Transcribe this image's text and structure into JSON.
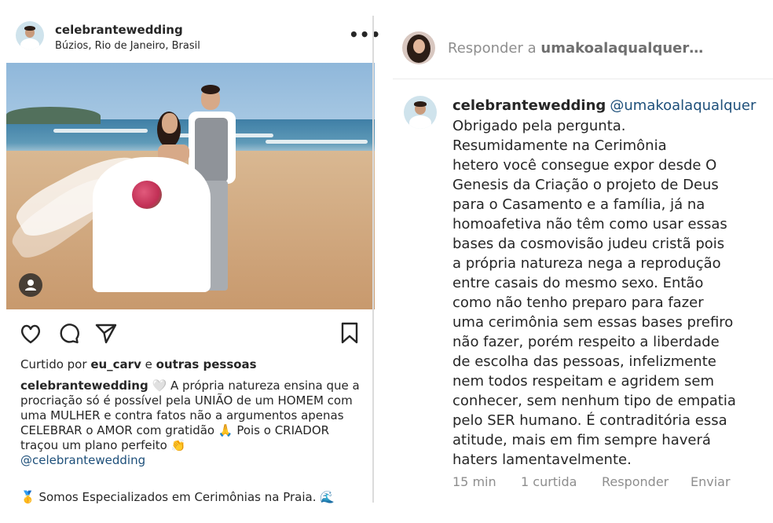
{
  "post": {
    "username": "celebrantewedding",
    "location": "Búzios, Rio de Janeiro, Brasil",
    "more_label": "•••",
    "likes_prefix": "Curtido por",
    "likes_user": "eu_carv",
    "likes_joiner": "e",
    "likes_others": "outras pessoas",
    "caption_username": "celebrantewedding",
    "caption_text": "🤍 A própria natureza ensina que a procriação só é possível pela UNIÃO de um HOMEM com uma MULHER e contra fatos não a argumentos apenas CELEBRAR o AMOR com gratidão 🙏 Pois o CRIADOR traçou um plano perfeito 👏",
    "caption_mention": "@celebrantewedding",
    "specialty_text": "🥇 Somos Especializados em Cerimônias na Praia. 🌊"
  },
  "reply_bar": {
    "prefix": "Responder a",
    "target": "umakoalaqualquer…"
  },
  "comment": {
    "username": "celebrantewedding",
    "mention": "@umakoalaqualquer",
    "text": "Obrigado pela pergunta.\nResumidamente na Cerimônia\nhetero você consegue expor desde O\nGenesis da Criação o projeto de Deus\npara o Casamento e a família, já na\nhomoafetiva não têm como usar essas\nbases da cosmovisão judeu cristã pois\na própria natureza nega a reprodução\nentre casais do mesmo sexo. Então\ncomo não tenho preparo para fazer\numa cerimônia sem essas bases prefiro\nnão fazer, porém respeito a liberdade\nde escolha das pessoas, infelizmente\nnem todos respeitam e agridem sem\nconhecer, sem nenhum tipo de empatia\npelo SER humano. É contraditória essa\natitude, mais em fim sempre haverá\nhaters lamentavelmente.",
    "time": "15 min",
    "likes": "1 curtida",
    "reply_label": "Responder",
    "send_label": "Enviar"
  },
  "icons": {
    "like": "heart-icon",
    "comment": "comment-icon",
    "share": "send-icon",
    "save": "bookmark-icon",
    "tags": "user-tag-icon",
    "more": "more-options-icon"
  },
  "colors": {
    "text": "#262626",
    "muted": "#8e8e8e",
    "link": "#1d4f7a"
  }
}
